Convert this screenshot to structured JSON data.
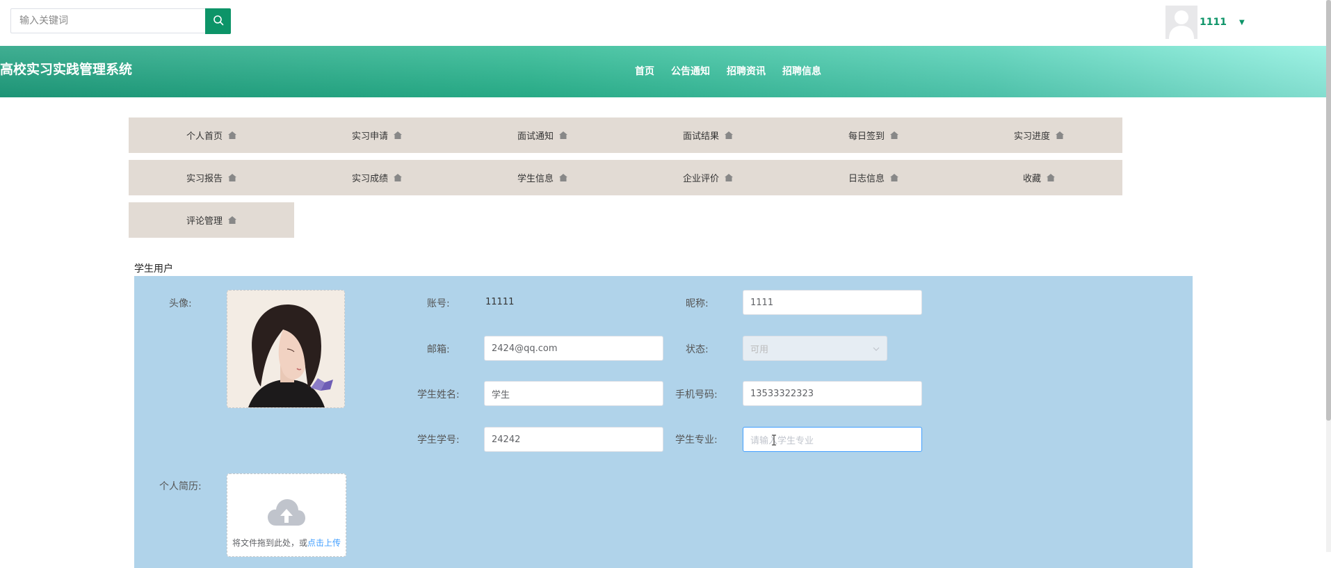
{
  "search": {
    "placeholder": "输入关键词"
  },
  "user": {
    "name": "1111"
  },
  "header": {
    "site_title": "高校实习实践管理系统",
    "nav": [
      "首页",
      "公告通知",
      "招聘资讯",
      "招聘信息"
    ]
  },
  "menu": {
    "row1": [
      "个人首页",
      "实习申请",
      "面试通知",
      "面试结果",
      "每日签到",
      "实习进度"
    ],
    "row2": [
      "实习报告",
      "实习成绩",
      "学生信息",
      "企业评价",
      "日志信息",
      "收藏"
    ],
    "row3": [
      "评论管理"
    ]
  },
  "profile": {
    "section_title": "学生用户",
    "labels": {
      "avatar": "头像:",
      "account": "账号:",
      "nickname": "昵称:",
      "email": "邮箱:",
      "status": "状态:",
      "name": "学生姓名:",
      "phone": "手机号码:",
      "student_no": "学生学号:",
      "major": "学生专业:",
      "resume": "个人简历:"
    },
    "values": {
      "account": "11111",
      "nickname": "1111",
      "email": "2424@qq.com",
      "status": "可用",
      "name": "学生",
      "phone": "13533322323",
      "student_no": "24242",
      "major_placeholder": "请输入学生专业"
    },
    "upload": {
      "text": "将文件拖到此处，或",
      "link": "点击上传"
    }
  }
}
